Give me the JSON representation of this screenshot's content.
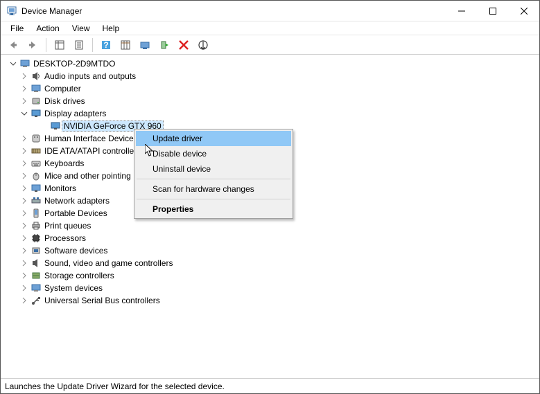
{
  "window": {
    "title": "Device Manager"
  },
  "menu": {
    "file": "File",
    "action": "Action",
    "view": "View",
    "help": "Help"
  },
  "tree": {
    "root": "DESKTOP-2D9MTDO",
    "nodes": {
      "audio": "Audio inputs and outputs",
      "computer": "Computer",
      "disk": "Disk drives",
      "display": "Display adapters",
      "gpu": "NVIDIA GeForce GTX 960",
      "hid": "Human Interface Device",
      "ide": "IDE ATA/ATAPI controlle",
      "kbd": "Keyboards",
      "mice": "Mice and other pointing",
      "mon": "Monitors",
      "net": "Network adapters",
      "port": "Portable Devices",
      "print": "Print queues",
      "proc": "Processors",
      "soft": "Software devices",
      "sound": "Sound, video and game controllers",
      "storage": "Storage controllers",
      "sys": "System devices",
      "usb": "Universal Serial Bus controllers"
    }
  },
  "context_menu": {
    "update": "Update driver",
    "disable": "Disable device",
    "uninstall": "Uninstall device",
    "scan": "Scan for hardware changes",
    "properties": "Properties"
  },
  "status": "Launches the Update Driver Wizard for the selected device."
}
